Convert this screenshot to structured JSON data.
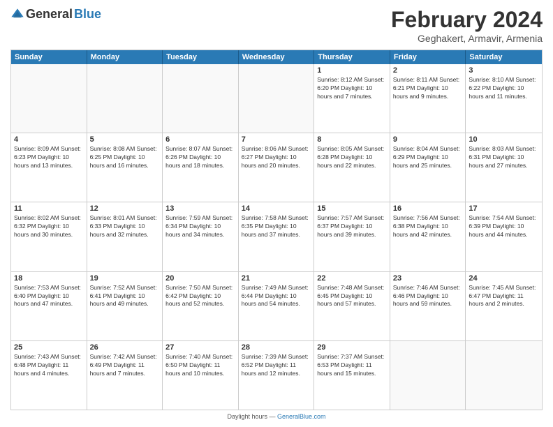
{
  "header": {
    "logo_general": "General",
    "logo_blue": "Blue",
    "title": "February 2024",
    "subtitle": "Geghakert, Armavir, Armenia"
  },
  "calendar": {
    "days_of_week": [
      "Sunday",
      "Monday",
      "Tuesday",
      "Wednesday",
      "Thursday",
      "Friday",
      "Saturday"
    ],
    "weeks": [
      [
        {
          "day": "",
          "info": ""
        },
        {
          "day": "",
          "info": ""
        },
        {
          "day": "",
          "info": ""
        },
        {
          "day": "",
          "info": ""
        },
        {
          "day": "1",
          "info": "Sunrise: 8:12 AM\nSunset: 6:20 PM\nDaylight: 10 hours and 7 minutes."
        },
        {
          "day": "2",
          "info": "Sunrise: 8:11 AM\nSunset: 6:21 PM\nDaylight: 10 hours and 9 minutes."
        },
        {
          "day": "3",
          "info": "Sunrise: 8:10 AM\nSunset: 6:22 PM\nDaylight: 10 hours and 11 minutes."
        }
      ],
      [
        {
          "day": "4",
          "info": "Sunrise: 8:09 AM\nSunset: 6:23 PM\nDaylight: 10 hours and 13 minutes."
        },
        {
          "day": "5",
          "info": "Sunrise: 8:08 AM\nSunset: 6:25 PM\nDaylight: 10 hours and 16 minutes."
        },
        {
          "day": "6",
          "info": "Sunrise: 8:07 AM\nSunset: 6:26 PM\nDaylight: 10 hours and 18 minutes."
        },
        {
          "day": "7",
          "info": "Sunrise: 8:06 AM\nSunset: 6:27 PM\nDaylight: 10 hours and 20 minutes."
        },
        {
          "day": "8",
          "info": "Sunrise: 8:05 AM\nSunset: 6:28 PM\nDaylight: 10 hours and 22 minutes."
        },
        {
          "day": "9",
          "info": "Sunrise: 8:04 AM\nSunset: 6:29 PM\nDaylight: 10 hours and 25 minutes."
        },
        {
          "day": "10",
          "info": "Sunrise: 8:03 AM\nSunset: 6:31 PM\nDaylight: 10 hours and 27 minutes."
        }
      ],
      [
        {
          "day": "11",
          "info": "Sunrise: 8:02 AM\nSunset: 6:32 PM\nDaylight: 10 hours and 30 minutes."
        },
        {
          "day": "12",
          "info": "Sunrise: 8:01 AM\nSunset: 6:33 PM\nDaylight: 10 hours and 32 minutes."
        },
        {
          "day": "13",
          "info": "Sunrise: 7:59 AM\nSunset: 6:34 PM\nDaylight: 10 hours and 34 minutes."
        },
        {
          "day": "14",
          "info": "Sunrise: 7:58 AM\nSunset: 6:35 PM\nDaylight: 10 hours and 37 minutes."
        },
        {
          "day": "15",
          "info": "Sunrise: 7:57 AM\nSunset: 6:37 PM\nDaylight: 10 hours and 39 minutes."
        },
        {
          "day": "16",
          "info": "Sunrise: 7:56 AM\nSunset: 6:38 PM\nDaylight: 10 hours and 42 minutes."
        },
        {
          "day": "17",
          "info": "Sunrise: 7:54 AM\nSunset: 6:39 PM\nDaylight: 10 hours and 44 minutes."
        }
      ],
      [
        {
          "day": "18",
          "info": "Sunrise: 7:53 AM\nSunset: 6:40 PM\nDaylight: 10 hours and 47 minutes."
        },
        {
          "day": "19",
          "info": "Sunrise: 7:52 AM\nSunset: 6:41 PM\nDaylight: 10 hours and 49 minutes."
        },
        {
          "day": "20",
          "info": "Sunrise: 7:50 AM\nSunset: 6:42 PM\nDaylight: 10 hours and 52 minutes."
        },
        {
          "day": "21",
          "info": "Sunrise: 7:49 AM\nSunset: 6:44 PM\nDaylight: 10 hours and 54 minutes."
        },
        {
          "day": "22",
          "info": "Sunrise: 7:48 AM\nSunset: 6:45 PM\nDaylight: 10 hours and 57 minutes."
        },
        {
          "day": "23",
          "info": "Sunrise: 7:46 AM\nSunset: 6:46 PM\nDaylight: 10 hours and 59 minutes."
        },
        {
          "day": "24",
          "info": "Sunrise: 7:45 AM\nSunset: 6:47 PM\nDaylight: 11 hours and 2 minutes."
        }
      ],
      [
        {
          "day": "25",
          "info": "Sunrise: 7:43 AM\nSunset: 6:48 PM\nDaylight: 11 hours and 4 minutes."
        },
        {
          "day": "26",
          "info": "Sunrise: 7:42 AM\nSunset: 6:49 PM\nDaylight: 11 hours and 7 minutes."
        },
        {
          "day": "27",
          "info": "Sunrise: 7:40 AM\nSunset: 6:50 PM\nDaylight: 11 hours and 10 minutes."
        },
        {
          "day": "28",
          "info": "Sunrise: 7:39 AM\nSunset: 6:52 PM\nDaylight: 11 hours and 12 minutes."
        },
        {
          "day": "29",
          "info": "Sunrise: 7:37 AM\nSunset: 6:53 PM\nDaylight: 11 hours and 15 minutes."
        },
        {
          "day": "",
          "info": ""
        },
        {
          "day": "",
          "info": ""
        }
      ]
    ]
  },
  "footer": {
    "text": "Daylight hours",
    "url_text": "GeneralBlue.com"
  }
}
